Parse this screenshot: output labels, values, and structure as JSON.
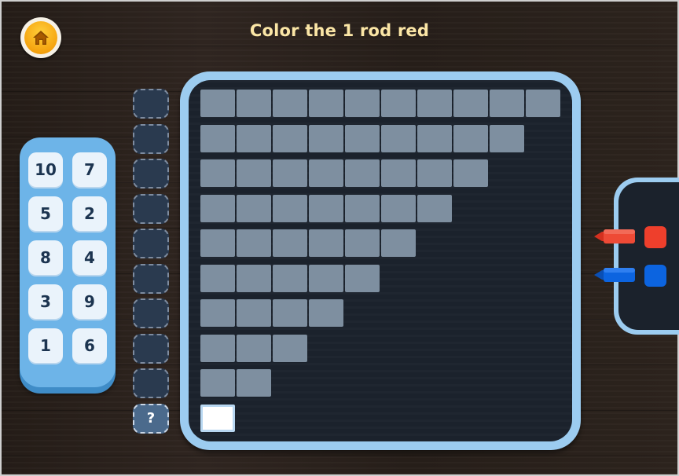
{
  "header": {
    "title": "Color the 1 rod red",
    "home_icon": "home-icon",
    "home_color": "#f5a30f"
  },
  "number_tray": {
    "tiles": [
      "10",
      "7",
      "5",
      "2",
      "8",
      "4",
      "3",
      "9",
      "1",
      "6"
    ]
  },
  "answer_slots": {
    "count": 10,
    "active_label": "?"
  },
  "rods": {
    "lengths": [
      10,
      9,
      8,
      7,
      6,
      5,
      4,
      3,
      2,
      1
    ],
    "selected_rod": 1,
    "cube_color": "#7e8fa0",
    "selected_color": "#ffffff"
  },
  "colors": {
    "red": "#ee3f2c",
    "blue": "#0c64e0",
    "board_border": "#9cccf0",
    "board_fill": "#1b222c"
  }
}
